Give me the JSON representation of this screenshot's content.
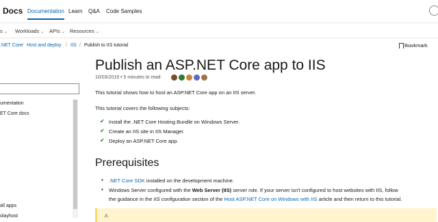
{
  "header": {
    "brand": "Docs",
    "nav": [
      "Documentation",
      "Learn",
      "Q&A",
      "Code Samples"
    ]
  },
  "secondary_nav": [
    "s",
    "Workloads",
    "APIs",
    "Resources"
  ],
  "breadcrumb": [
    ".NET Core",
    "Host and deploy",
    "IIS",
    "Publish to IIS tutorial"
  ],
  "bookmark_label": "Bookmark",
  "sidebar": {
    "items": [
      "umentation",
      "ET Core docs",
      "all apps",
      "olayhost"
    ]
  },
  "article": {
    "title": "Publish an ASP.NET Core app to IIS",
    "date": "10/03/2019",
    "read_time": "5 minutes to read",
    "intro": "This tutorial shows how to host an ASP.NET Core app on an IIS server.",
    "covers": "This tutorial covers the following subjects:",
    "subjects": [
      "Install the .NET Core Hosting Bundle on Windows Server.",
      "Create an IIS site in IIS Manager.",
      "Deploy an ASP.NET Core app."
    ],
    "prereq_heading": "Prerequisites",
    "prereq1_link": ".NET Core SDK",
    "prereq1_rest": " installed on the development machine.",
    "prereq2_a": "Windows Server configured with the ",
    "prereq2_bold": "Web Server (IIS)",
    "prereq2_b": " server role. If your server isn't configured to host websites with IIS, follow",
    "prereq2_c": "the guidance in the ",
    "prereq2_italic": "IIS configuration",
    "prereq2_d": " section of the ",
    "prereq2_link": "Host ASP.NET Core on Windows with IIS",
    "prereq2_e": " article and then return to this tutorial."
  },
  "colors": {
    "accent": "#0065b3",
    "check": "#107c10",
    "note_bg": "#fff4ce"
  }
}
